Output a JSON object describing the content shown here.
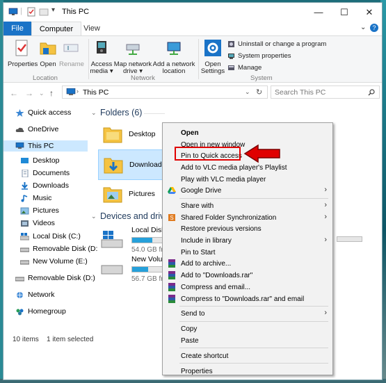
{
  "window": {
    "title": "This PC"
  },
  "tabs": {
    "file": "File",
    "computer": "Computer",
    "view": "View"
  },
  "ribbon": {
    "location": {
      "properties": "Properties",
      "open": "Open",
      "rename": "Rename",
      "label": "Location"
    },
    "network": {
      "access_media_1": "Access",
      "access_media_2": "media ▾",
      "map_drive_1": "Map network",
      "map_drive_2": "drive ▾",
      "add_location_1": "Add a network",
      "add_location_2": "location",
      "label": "Network"
    },
    "system": {
      "open_settings_1": "Open",
      "open_settings_2": "Settings",
      "uninstall": "Uninstall or change a program",
      "system_properties": "System properties",
      "manage": "Manage",
      "label": "System"
    }
  },
  "address": {
    "path": "This PC",
    "search_placeholder": "Search This PC"
  },
  "sidebar": {
    "items": [
      {
        "label": "Quick access"
      },
      {
        "label": "OneDrive"
      },
      {
        "label": "This PC"
      },
      {
        "label": "Desktop"
      },
      {
        "label": "Documents"
      },
      {
        "label": "Downloads"
      },
      {
        "label": "Music"
      },
      {
        "label": "Pictures"
      },
      {
        "label": "Videos"
      },
      {
        "label": "Local Disk (C:)"
      },
      {
        "label": "Removable Disk (D:"
      },
      {
        "label": "New Volume (E:)"
      },
      {
        "label": "Removable Disk (D:)"
      },
      {
        "label": "Network"
      },
      {
        "label": "Homegroup"
      }
    ]
  },
  "main": {
    "folders_heading": "Folders (6)",
    "devices_heading": "Devices and drives",
    "folders": [
      {
        "label": "Desktop"
      },
      {
        "label": "Downloads"
      },
      {
        "label": "Pictures"
      }
    ],
    "drives": [
      {
        "name": "Local Disk (C:",
        "free": "54.0 GB free",
        "used_fraction": 0.55
      },
      {
        "name": "New Volume",
        "free": "56.7 GB free",
        "used_fraction": 0.45
      }
    ]
  },
  "status": {
    "items": "10 items",
    "selected": "1 item selected"
  },
  "context_menu": {
    "items": {
      "open": "Open",
      "open_new_window": "Open in new window",
      "pin_quick_access": "Pin to Quick access",
      "vlc_playlist": "Add to VLC media player's Playlist",
      "vlc_play": "Play with VLC media player",
      "google_drive": "Google Drive",
      "share_with": "Share with",
      "shared_folder_sync": "Shared Folder Synchronization",
      "restore_versions": "Restore previous versions",
      "include_library": "Include in library",
      "pin_start": "Pin to Start",
      "add_archive": "Add to archive...",
      "add_rar": "Add to \"Downloads.rar\"",
      "compress_email": "Compress and email...",
      "compress_rar_email": "Compress to \"Downloads.rar\" and email",
      "send_to": "Send to",
      "copy": "Copy",
      "paste": "Paste",
      "create_shortcut": "Create shortcut",
      "properties": "Properties"
    }
  },
  "colors": {
    "accent": "#1a73c7",
    "selection": "#cce8ff",
    "highlight": "#e00000",
    "drive_fill": "#26a0da"
  }
}
